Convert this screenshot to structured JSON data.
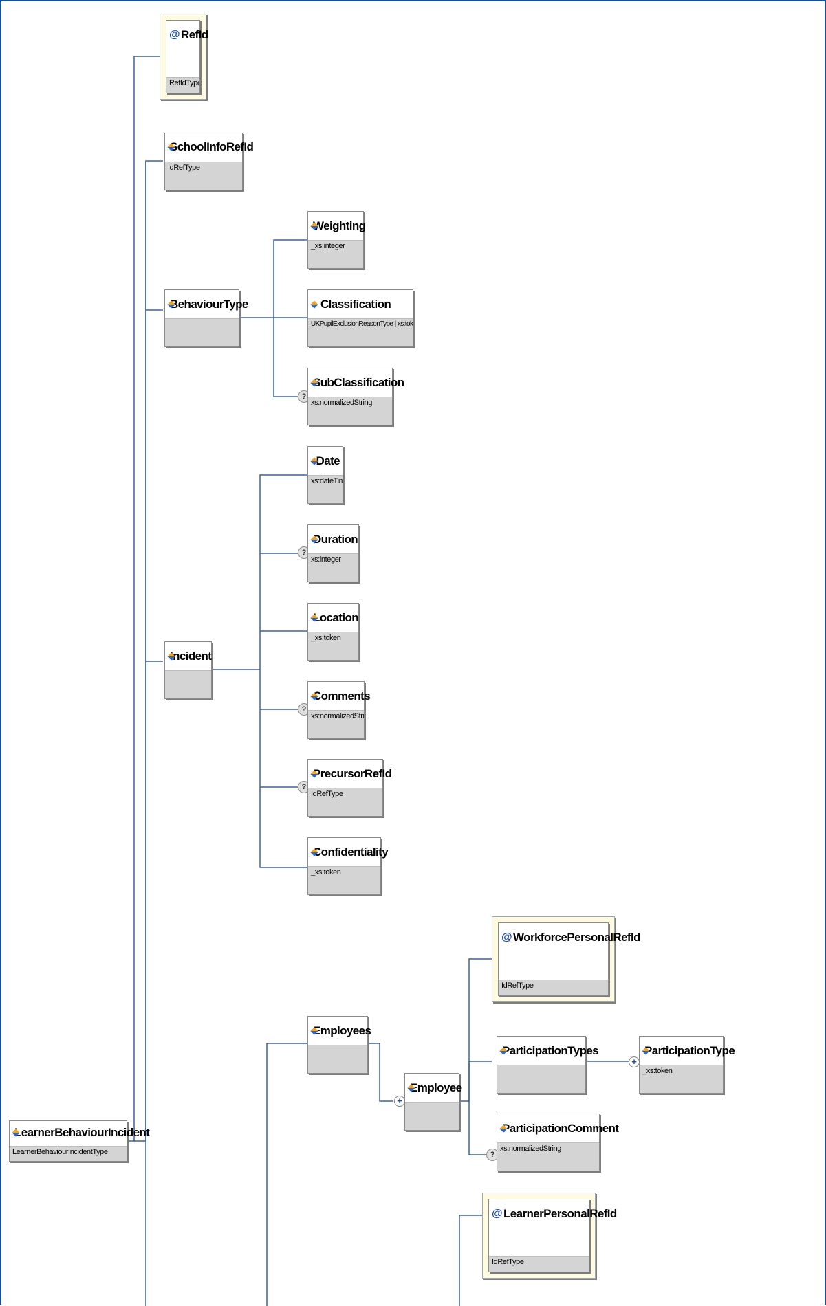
{
  "diagram": {
    "root": {
      "name": "LearnerBehaviourIncident",
      "type": "LearnerBehaviourIncidentType"
    },
    "nodes": {
      "refid": {
        "name": "RefId",
        "type": "RefIdType"
      },
      "schoolinforefid": {
        "name": "SchoolInfoRefId",
        "type": "IdRefType"
      },
      "behaviourtype": {
        "name": "BehaviourType",
        "type": ""
      },
      "weighting": {
        "name": "Weighting",
        "type": "_xs:integer"
      },
      "classification": {
        "name": "Classification",
        "type": "UKPupilExclusionReasonType | xs:token"
      },
      "subclassification": {
        "name": "SubClassification",
        "type": "xs:normalizedString"
      },
      "incident": {
        "name": "Incident",
        "type": ""
      },
      "date": {
        "name": "Date",
        "type": "xs:dateTime"
      },
      "duration": {
        "name": "Duration",
        "type": "xs:integer"
      },
      "location": {
        "name": "Location",
        "type": "_xs:token"
      },
      "comments": {
        "name": "Comments",
        "type": "xs:normalizedString"
      },
      "precursorrefid": {
        "name": "PrecursorRefId",
        "type": "IdRefType"
      },
      "confidentiality": {
        "name": "Confidentiality",
        "type": "_xs:token"
      },
      "employees": {
        "name": "Employees",
        "type": ""
      },
      "employee": {
        "name": "Employee",
        "type": ""
      },
      "workforcepersonalrefid": {
        "name": "WorkforcePersonalRefId",
        "type": "IdRefType"
      },
      "participationtypes": {
        "name": "ParticipationTypes",
        "type": ""
      },
      "participationtype": {
        "name": "ParticipationType",
        "type": "_xs:token"
      },
      "participationcomment": {
        "name": "ParticipationComment",
        "type": "xs:normalizedString"
      },
      "learnerpersonalrefid": {
        "name": "LearnerPersonalRefId",
        "type": "IdRefType"
      }
    },
    "markers": {
      "optional": "?",
      "expand": "+"
    },
    "colors": {
      "frame": "#1c4f8f",
      "connector": "#3a64a3",
      "type_bar": "#d4d4d4",
      "attribute_bg": "#fffbe0"
    }
  }
}
